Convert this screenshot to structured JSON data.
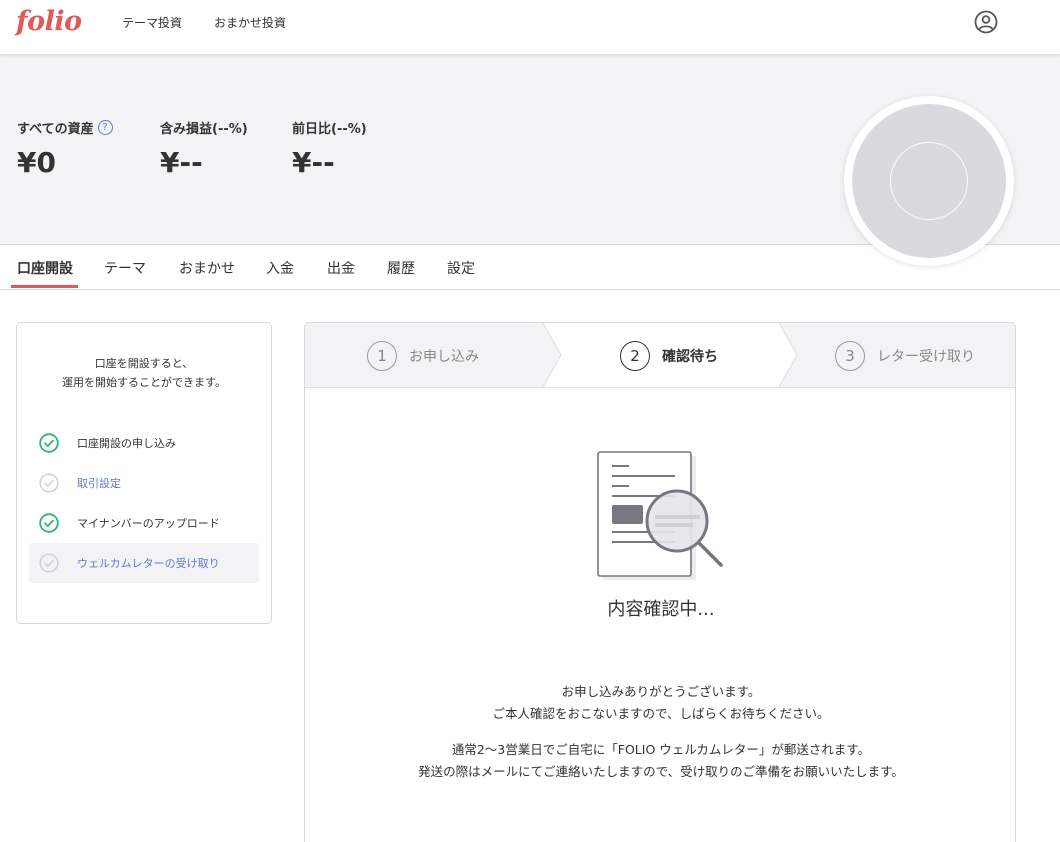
{
  "header": {
    "logo": "folio",
    "nav": [
      "テーマ投資",
      "おまかせ投資"
    ],
    "user_icon": "user-circle-icon"
  },
  "summary": {
    "total_assets_label": "すべての資産",
    "total_assets_help": "?",
    "total_assets_value": "¥0",
    "unrealized_label": "含み損益(--%)",
    "unrealized_value": "¥--",
    "day_change_label": "前日比(--%)",
    "day_change_value": "¥--"
  },
  "tabs": [
    "口座開設",
    "テーマ",
    "おまかせ",
    "入金",
    "出金",
    "履歴",
    "設定"
  ],
  "active_tab_index": 0,
  "sidebar": {
    "intro_line1": "口座を開設すると、",
    "intro_line2": "運用を開始することができます。",
    "steps": [
      {
        "label": "口座開設の申し込み",
        "status": "done"
      },
      {
        "label": "取引設定",
        "status": "pending"
      },
      {
        "label": "マイナンバーのアップロード",
        "status": "done"
      },
      {
        "label": "ウェルカムレターの受け取り",
        "status": "pending",
        "highlighted": true
      }
    ]
  },
  "progress": {
    "steps": [
      {
        "num": "1",
        "label": "お申し込み"
      },
      {
        "num": "2",
        "label": "確認待ち"
      },
      {
        "num": "3",
        "label": "レター受け取り"
      }
    ],
    "active_index": 1
  },
  "status": {
    "illustration": "document-magnifier-icon",
    "title": "内容確認中...",
    "msg1_line1": "お申し込みありがとうございます。",
    "msg1_line2": "ご本人確認をおこないますので、しばらくお待ちください。",
    "msg2_line1": "通常2〜3営業日でご自宅に「FOLIO ウェルカムレター」が郵送されます。",
    "msg2_line2": "発送の際はメールにてご連絡いたしますので、受け取りのご準備をお願いいたします。"
  },
  "colors": {
    "brand": "#e05a5a",
    "link": "#5b7ad6",
    "check_done": "#2bb673",
    "check_pending": "#d0d0d0",
    "summary_bg": "#f3f3f5"
  }
}
